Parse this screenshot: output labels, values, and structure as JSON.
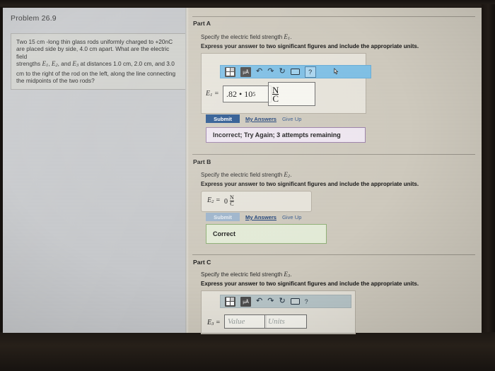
{
  "left_panel": {
    "problem_title": "Problem 26.9",
    "problem_text_1": "Two 15 cm -long thin glass rods uniformly charged to +20nC",
    "problem_text_2": "are placed side by side, 4.0 cm apart. What are the electric field",
    "problem_text_3a": "strengths ",
    "problem_text_3b": " at distances 1.0 cm, 2.0 cm, and 3.0",
    "problem_text_4": "cm to the right of the rod on the left, along the line connecting",
    "problem_text_5": "the midpoints of the two rods?"
  },
  "toolbar": {
    "template_icon": "template-grid-icon",
    "units_label": "μÅ",
    "undo_icon": "undo-arrow-icon",
    "redo_icon": "redo-arrow-icon",
    "reset_icon": "reset-circle-icon",
    "keyboard_icon": "keyboard-icon",
    "help_label": "?"
  },
  "actions": {
    "submit": "Submit",
    "my_answers": "My Answers",
    "give_up": "Give Up"
  },
  "parts": [
    {
      "heading": "Part A",
      "question_prefix": "Specify the electric field strength ",
      "question_symbol": "E",
      "question_sub": "1",
      "question_suffix": ".",
      "instruction": "Express your answer to two significant figures and include the appropriate units.",
      "answer_label_symbol": "E",
      "answer_label_sub": "1",
      "answer_equals": "=",
      "value": ".82 • 10",
      "value_exp": "5",
      "unit_num": "N",
      "unit_den": "C",
      "toolbar_state": "active",
      "submit_state": "enabled",
      "feedback": "Incorrect; Try Again; 3 attempts remaining",
      "feedback_type": "incorrect"
    },
    {
      "heading": "Part B",
      "question_prefix": "Specify the electric field strength ",
      "question_symbol": "E",
      "question_sub": "2",
      "question_suffix": ".",
      "instruction": "Express your answer to two significant figures and include the appropriate units.",
      "answer_label_symbol": "E",
      "answer_label_sub": "2",
      "answer_equals": "=",
      "value": "0",
      "unit_num": "N",
      "unit_den": "C",
      "toolbar_state": "none",
      "submit_state": "disabled",
      "feedback": "Correct",
      "feedback_type": "correct"
    },
    {
      "heading": "Part C",
      "question_prefix": "Specify the electric field strength ",
      "question_symbol": "E",
      "question_sub": "3",
      "question_suffix": ".",
      "instruction": "Express your answer to two significant figures and include the appropriate units.",
      "answer_label_symbol": "E",
      "answer_label_sub": "3",
      "answer_equals": "=",
      "value_placeholder": "Value",
      "units_placeholder": "Units",
      "toolbar_state": "idle",
      "feedback": "",
      "feedback_type": "none"
    }
  ],
  "colors": {
    "submit_blue": "#27558f",
    "link_blue": "#1b3f78",
    "toolbar_active": "#7fc0e6",
    "toolbar_idle": "#b9c7ca",
    "incorrect_bg": "#efe7f1",
    "correct_bg": "#e4ecd8",
    "left_panel_bg": "#c6c8cb"
  }
}
